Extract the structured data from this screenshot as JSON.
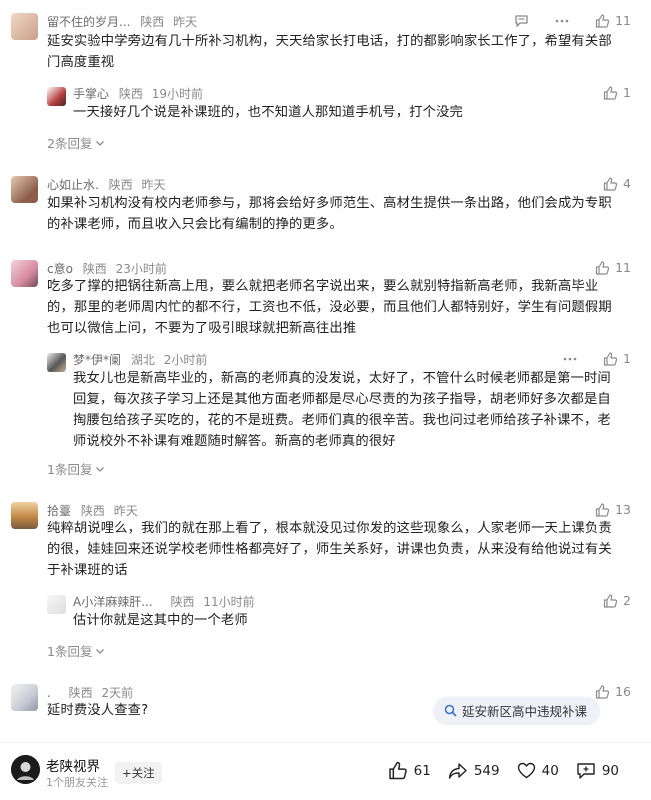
{
  "comments": [
    {
      "name": "留不住的岁月...",
      "region": "陕西",
      "time": "昨天",
      "likes": "11",
      "text": [
        "延安实验中学旁边有几十所补习机构，天天给家长打电话，打的都影响家长工作了，希望有关部",
        "门高度重视"
      ],
      "reply": {
        "name": "手掌心",
        "region": "陕西",
        "time": "19小时前",
        "likes": "1",
        "text": [
          "一天接好几个说是补课班的，也不知道人那知道手机号，打个没完"
        ]
      },
      "more": "2条回复"
    },
    {
      "name": "心如止水.",
      "region": "陕西",
      "time": "昨天",
      "likes": "4",
      "text": [
        "如果补习机构没有校内老师参与，那将会给好多师范生、高材生提供一条出路，他们会成为专职",
        "的补课老师，而且收入只会比有编制的挣的更多。"
      ]
    },
    {
      "name": "c意o",
      "region": "陕西",
      "time": "23小时前",
      "likes": "11",
      "text": [
        "吃多了撑的把锅往新高上甩，要么就把老师名字说出来，要么就别特指新高老师，我新高毕业",
        "的，那里的老师周内忙的都不行，工资也不低，没必要，而且他们人都特别好，学生有问题假期",
        "也可以微信上问，不要为了吸引眼球就把新高往出推"
      ],
      "reply": {
        "name": "梦*伊*阑",
        "region": "湖北",
        "time": "2小时前",
        "likes": "1",
        "text": [
          "我女儿也是新高毕业的，新高的老师真的没发说，太好了，不管什么时候老师都是第一时间",
          "回复，每次孩子学习上还是其他方面老师都是尽心尽责的为孩子指导，胡老师好多次都是自",
          "掏腰包给孩子买吃的，花的不是班费。老师们真的很辛苦。我也问过老师给孩子补课不，老",
          "师说校外不补课有难题随时解答。新高的老师真的很好"
        ]
      },
      "more": "1条回复"
    },
    {
      "name": "拾薹",
      "region": "陕西",
      "time": "昨天",
      "likes": "13",
      "text": [
        "纯粹胡说哩么，我们的就在那上看了，根本就没见过你发的这些现象么，人家老师一天上课负责",
        "的很，娃娃回来还说学校老师性格都亮好了，师生关系好，讲课也负责，从来没有给他说过有关",
        "于补课班的话"
      ],
      "reply": {
        "name": "A小洋麻辣肝...",
        "region": "陕西",
        "time": "11小时前",
        "likes": "2",
        "text": [
          "估计你就是这其中的一个老师"
        ]
      },
      "more": "1条回复"
    },
    {
      "name": ".",
      "region": "陕西",
      "time": "2天前",
      "likes": "16",
      "text": [
        "延时费没人查查?"
      ]
    }
  ],
  "search_chip": "延安新区高中违规补课",
  "author": {
    "name": "老陕视界",
    "sub": "1个朋友关注",
    "follow": "+关注"
  },
  "stats": {
    "likes": "61",
    "shares": "549",
    "favorites": "40",
    "comments": "90"
  }
}
